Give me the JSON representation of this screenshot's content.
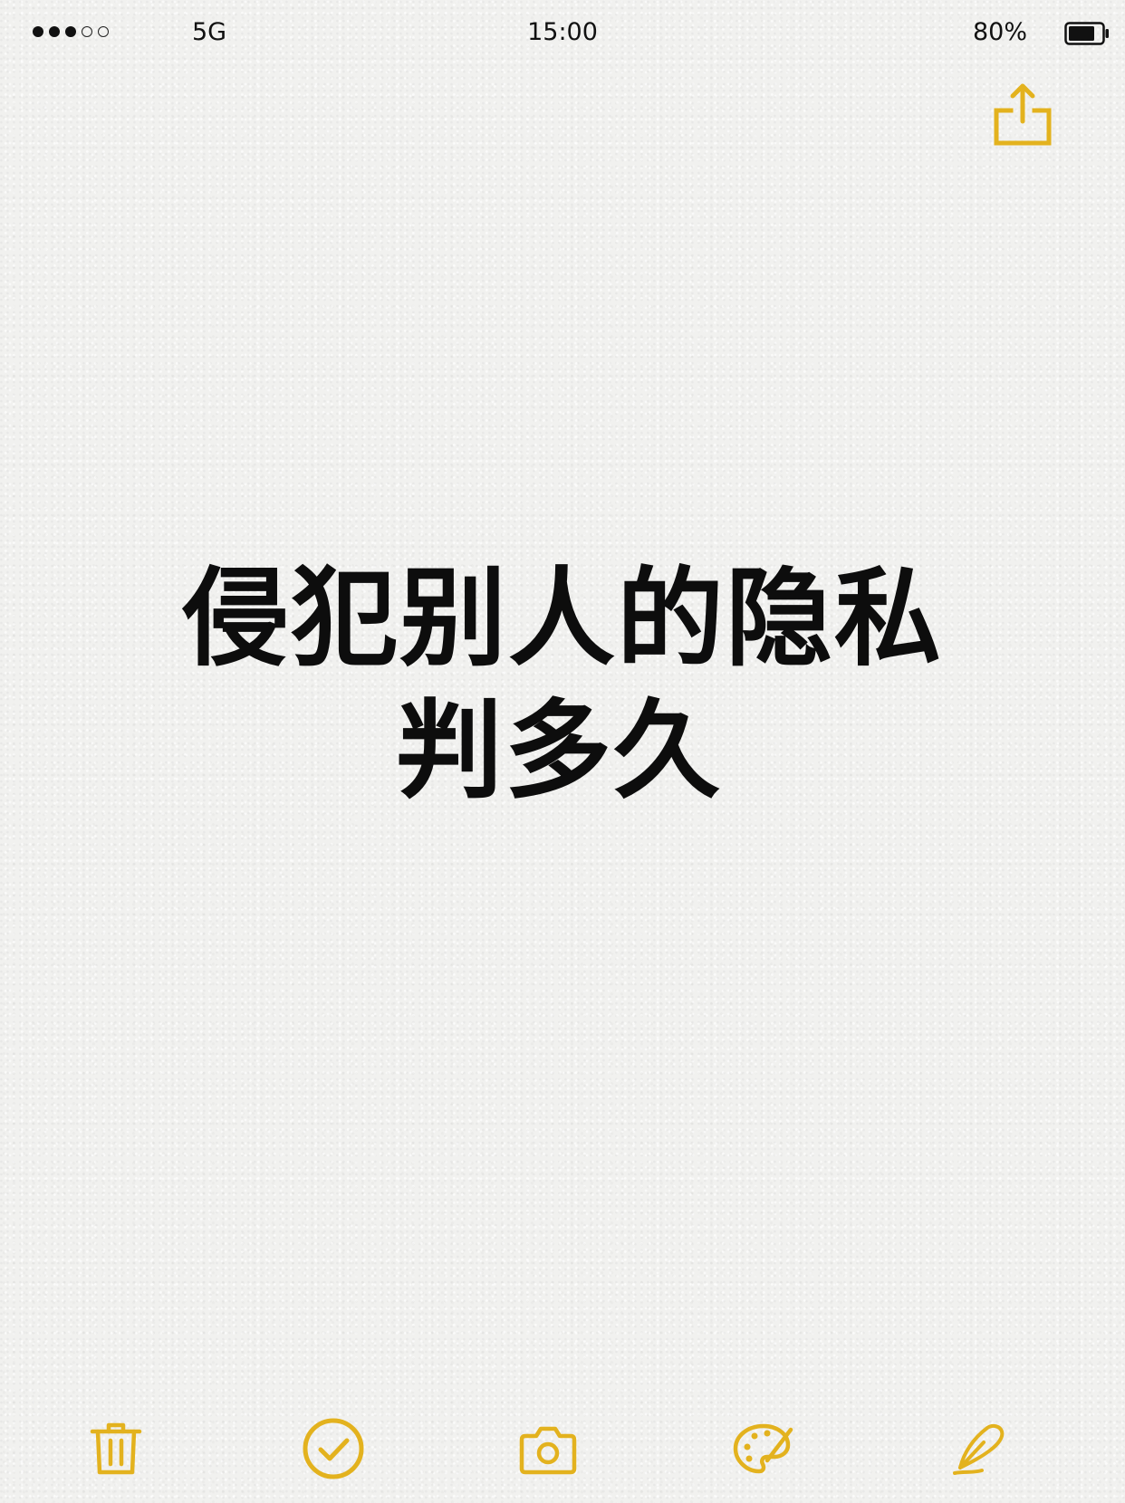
{
  "status_bar": {
    "signal_filled": 3,
    "signal_total": 5,
    "carrier": "5G",
    "time": "15:00",
    "battery_percent": "80%",
    "battery_level": 0.8
  },
  "note": {
    "title_line1": "侵犯别人的隐私",
    "title_line2": "判多久"
  },
  "toolbar": {
    "items": [
      {
        "icon": "trash-icon"
      },
      {
        "icon": "checkmark-circle-icon"
      },
      {
        "icon": "camera-icon"
      },
      {
        "icon": "palette-icon"
      },
      {
        "icon": "pen-icon"
      }
    ]
  },
  "colors": {
    "accent": "#E3B21E",
    "text": "#0D0D0D",
    "background": "#F1F1EF"
  }
}
